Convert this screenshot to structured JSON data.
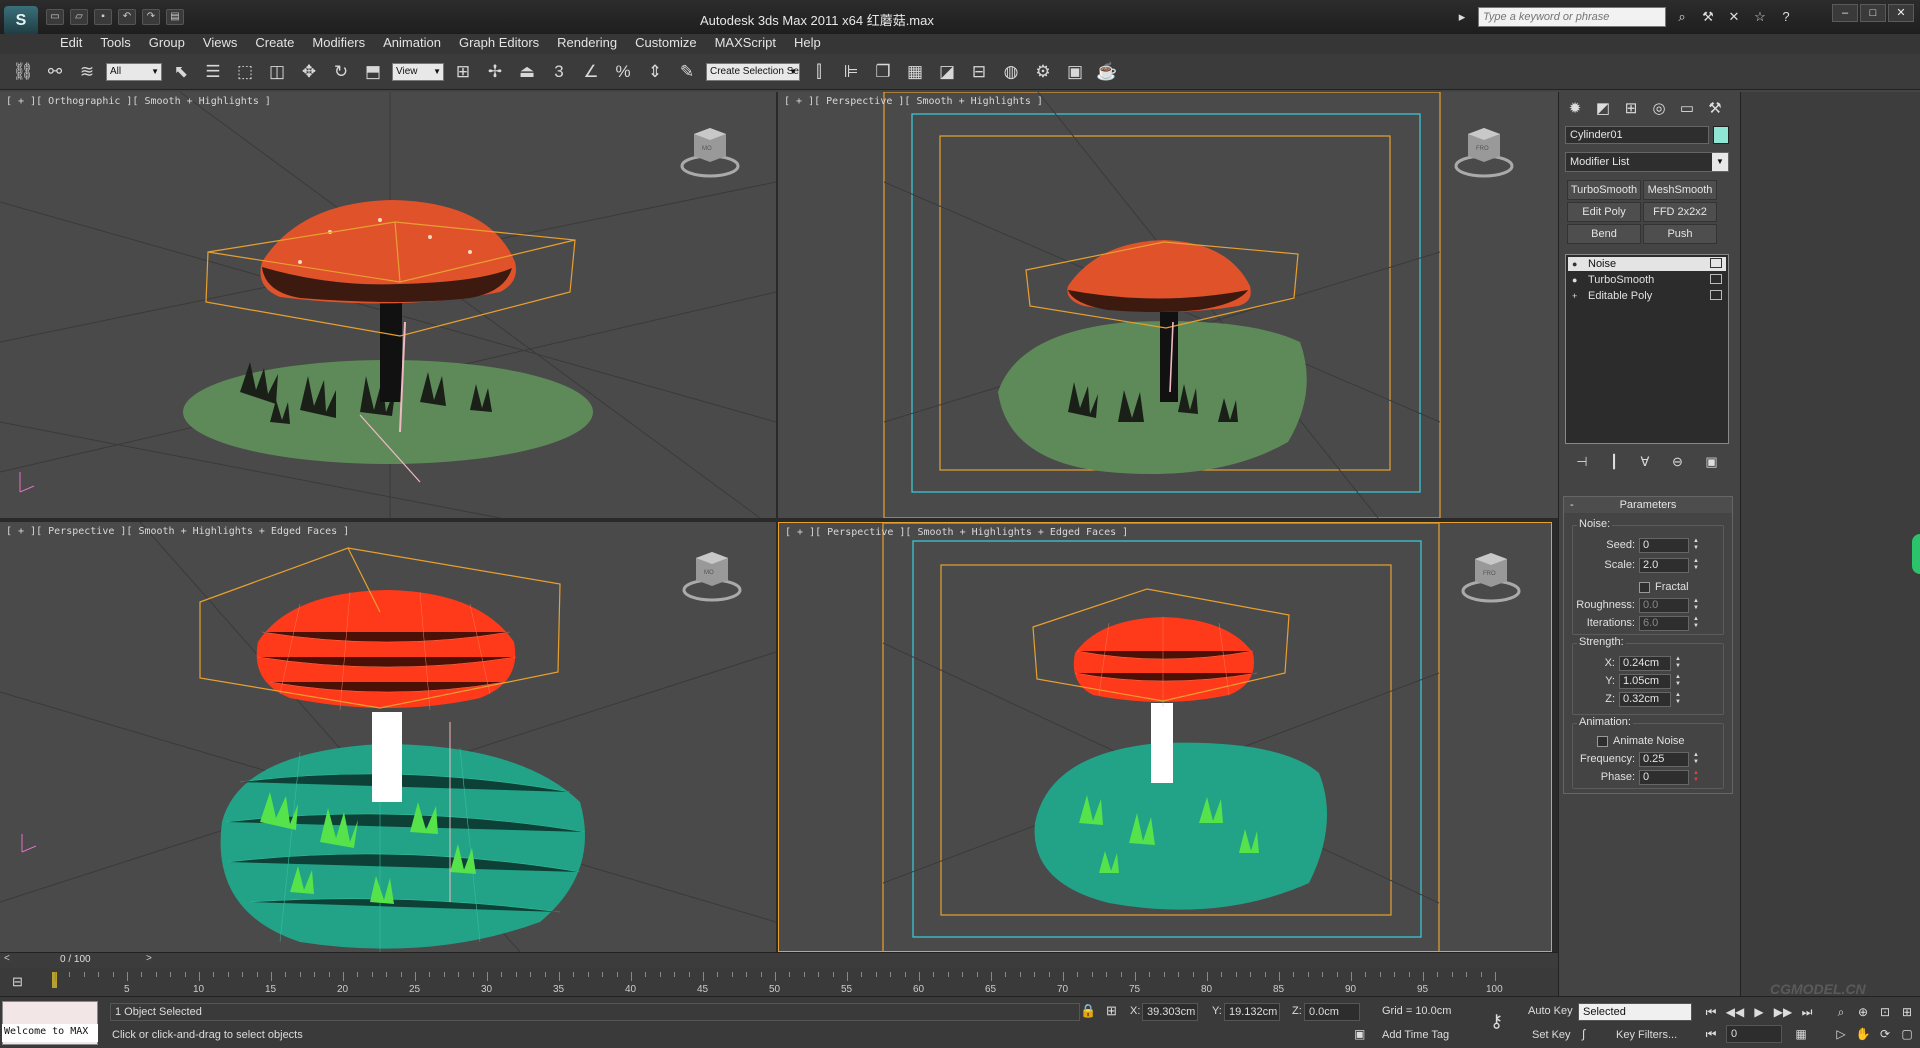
{
  "window": {
    "title": "Autodesk 3ds Max  2011 x64     红蘑菇.max",
    "search_placeholder": "Type a keyword or phrase"
  },
  "menu": [
    "Edit",
    "Tools",
    "Group",
    "Views",
    "Create",
    "Modifiers",
    "Animation",
    "Graph Editors",
    "Rendering",
    "Customize",
    "MAXScript",
    "Help"
  ],
  "toolbar": {
    "filter_value": "All",
    "refcoord_value": "View",
    "selection_set_value": "Create Selection Se",
    "snap_label": "3",
    "percent_label": "%"
  },
  "viewports": [
    {
      "label": "[ + ][ Orthographic ][ Smooth + Highlights ]",
      "cube_text": "MO"
    },
    {
      "label": "[ + ][ Perspective ][ Smooth + Highlights ]",
      "cube_text": "FRO"
    },
    {
      "label": "[ + ][ Perspective ][ Smooth + Highlights + Edged Faces ]",
      "cube_text": "MO"
    },
    {
      "label": "[ + ][ Perspective ][ Smooth + Highlights + Edged Faces ]",
      "cube_text": "FRO"
    }
  ],
  "timeline": {
    "frame_display": "0 / 100",
    "ticks": [
      "5",
      "10",
      "15",
      "20",
      "25",
      "30",
      "35",
      "40",
      "45",
      "50",
      "55",
      "60",
      "65",
      "70",
      "75",
      "80",
      "85",
      "90",
      "95",
      "100"
    ]
  },
  "status": {
    "maxscript_text": "Welcome to MAX",
    "selection_info": "1 Object Selected",
    "prompt": "Click or click-and-drag to select objects",
    "x_label": "X:",
    "x_value": "39.303cm",
    "y_label": "Y:",
    "y_value": "19.132cm",
    "z_label": "Z:",
    "z_value": "0.0cm",
    "grid": "Grid = 10.0cm",
    "add_time_tag": "Add Time Tag",
    "auto_key": "Auto Key",
    "set_key": "Set Key",
    "selected_value": "Selected",
    "key_filters": "Key Filters...",
    "frame_value": "0",
    "watermark": "CGMODEL.CN"
  },
  "command_panel": {
    "object_name": "Cylinder01",
    "object_color": "#8fe6d4",
    "modifier_list": "Modifier List",
    "modifier_buttons": [
      "TurboSmooth",
      "MeshSmooth",
      "Edit Poly",
      "FFD 2x2x2",
      "Bend",
      "Push"
    ],
    "stack": [
      "Noise",
      "TurboSmooth",
      "Editable Poly"
    ],
    "rollout_title": "Parameters",
    "noise_group": "Noise:",
    "seed_label": "Seed:",
    "seed_value": "0",
    "scale_label": "Scale:",
    "scale_value": "2.0",
    "fractal_label": "Fractal",
    "roughness_label": "Roughness:",
    "roughness_value": "0.0",
    "iterations_label": "Iterations:",
    "iterations_value": "6.0",
    "strength_group": "Strength:",
    "sx_label": "X:",
    "sx_value": "0.24cm",
    "sy_label": "Y:",
    "sy_value": "1.05cm",
    "sz_label": "Z:",
    "sz_value": "0.32cm",
    "animation_group": "Animation:",
    "animate_noise_label": "Animate Noise",
    "frequency_label": "Frequency:",
    "frequency_value": "0.25",
    "phase_label": "Phase:",
    "phase_value": "0"
  },
  "colors": {
    "cap_red": "#e0522a",
    "grass_green": "#5e8a5a",
    "wire_cap": "#ff3a1a",
    "wire_base": "#22a388",
    "selection_orange": "#e8a030",
    "safe_frame_cyan": "#3ad0e0"
  }
}
